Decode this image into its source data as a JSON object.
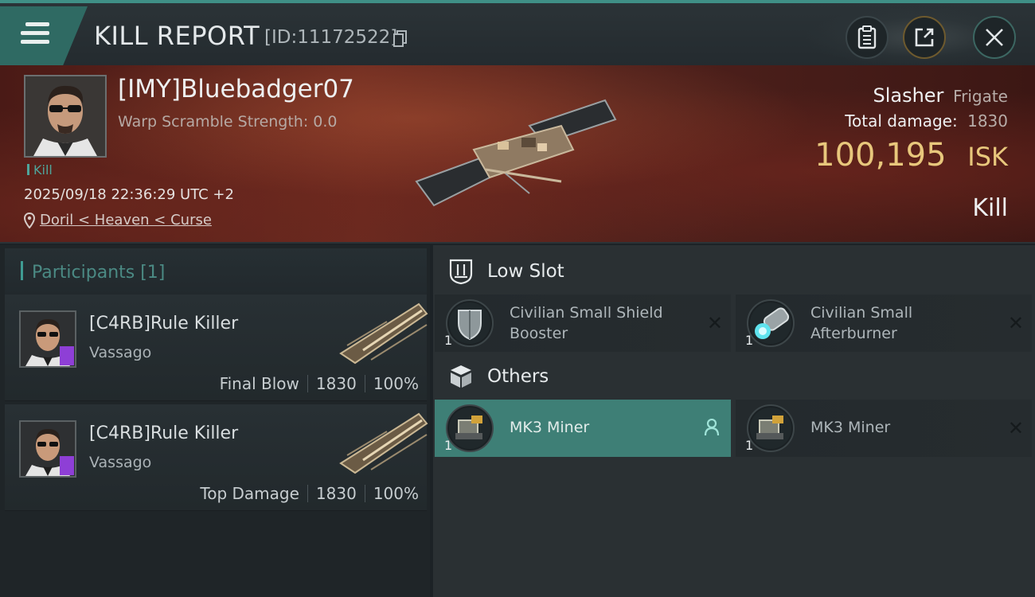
{
  "header": {
    "title": "KILL REPORT",
    "report_id": "[ID:11172522]"
  },
  "victim": {
    "name": "[IMY]Bluebadger07",
    "warp_scramble": "Warp Scramble Strength: 0.0",
    "tag": "Kill",
    "datetime": "2025/09/18 22:36:29 UTC +2",
    "location": "Doril < Heaven < Curse",
    "ship": "Slasher",
    "ship_class": "Frigate",
    "total_damage_label": "Total damage:",
    "total_damage": "1830",
    "isk_value": "100,195",
    "isk_unit": "ISK",
    "result": "Kill"
  },
  "participants": {
    "title": "Participants [1]",
    "rows": [
      {
        "name": "[C4RB]Rule Killer",
        "ship": "Vassago",
        "role": "Final Blow",
        "damage": "1830",
        "percent": "100%"
      },
      {
        "name": "[C4RB]Rule Killer",
        "ship": "Vassago",
        "role": "Top Damage",
        "damage": "1830",
        "percent": "100%"
      }
    ]
  },
  "low_slot": {
    "title": "Low Slot",
    "modules": [
      {
        "qty": "1",
        "name": "Civilian Small Shield Booster",
        "icon": "shield-booster-icon"
      },
      {
        "qty": "1",
        "name": "Civilian Small Afterburner",
        "icon": "afterburner-icon"
      }
    ]
  },
  "others": {
    "title": "Others",
    "modules": [
      {
        "qty": "1",
        "name": "MK3 Miner",
        "icon": "miner-icon"
      },
      {
        "qty": "1",
        "name": "MK3 Miner",
        "icon": "miner-icon"
      }
    ]
  },
  "colors": {
    "accent": "#3f8f86",
    "isk_gold": "#e8c77c",
    "active_module": "#3e7f76",
    "badge_purple": "#8e3fd6"
  }
}
